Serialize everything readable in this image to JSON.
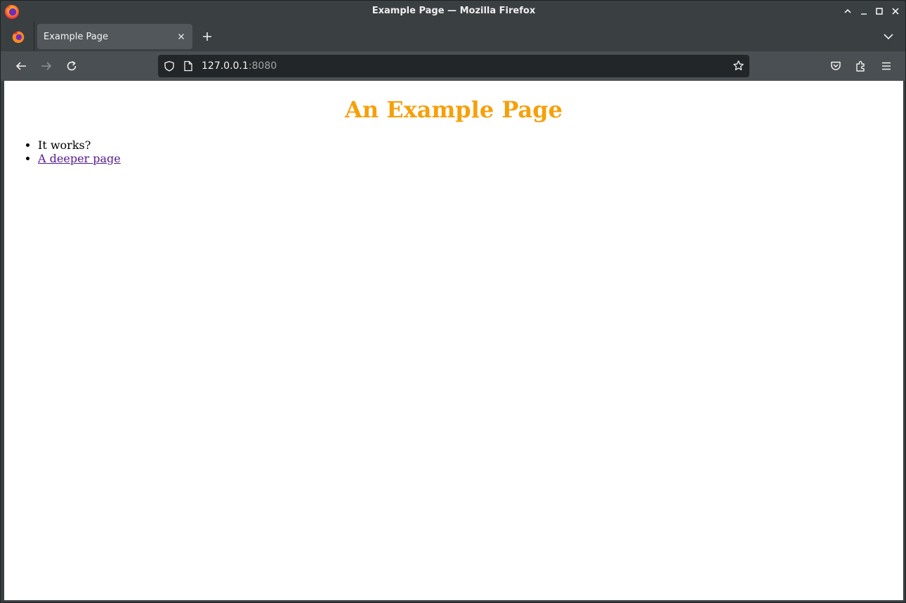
{
  "window": {
    "title": "Example Page — Mozilla Firefox"
  },
  "tabs": [
    {
      "title": "Example Page",
      "active": true
    }
  ],
  "navbar": {
    "url_host": "127.0.0.1",
    "url_port": ":8080"
  },
  "page": {
    "heading": "An Example Page",
    "heading_color": "#f5a00b",
    "items": [
      {
        "text": "It works?",
        "is_link": false
      },
      {
        "text": "A deeper page",
        "is_link": true
      }
    ]
  },
  "icons": {
    "app": "firefox-icon",
    "window_controls": [
      "chevron-up-icon",
      "minimize-icon",
      "maximize-icon",
      "close-icon"
    ],
    "nav": [
      "back-arrow-icon",
      "forward-arrow-icon",
      "reload-icon"
    ],
    "urlbar": [
      "shield-icon",
      "page-icon",
      "bookmark-star-icon"
    ],
    "toolbar": [
      "pocket-icon",
      "extensions-icon",
      "menu-icon"
    ]
  }
}
